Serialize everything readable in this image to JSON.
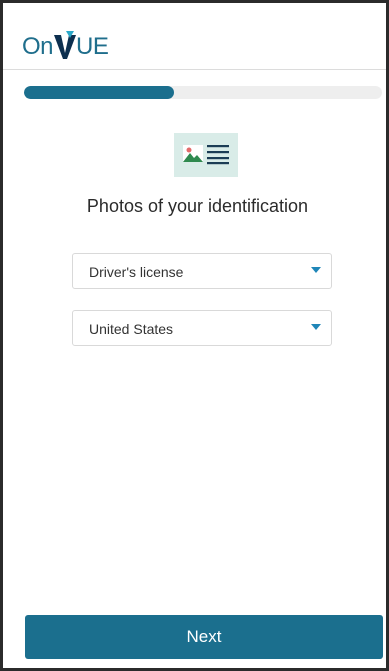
{
  "header": {
    "logo_prefix": "On",
    "logo_suffix": "UE",
    "logo_alt": "OnVUE"
  },
  "progress": {
    "fraction": 0.42,
    "color": "#1b6f8e",
    "track_color": "#eeeeee"
  },
  "main": {
    "icon": "id-photo-icon",
    "title": "Photos of your identification",
    "id_type": {
      "selected": "Driver's license"
    },
    "country": {
      "selected": "United States"
    }
  },
  "footer": {
    "next_label": "Next"
  },
  "colors": {
    "brand": "#1b6f8e",
    "caret": "#1f86b8",
    "icon_bg": "#d9ece8"
  }
}
